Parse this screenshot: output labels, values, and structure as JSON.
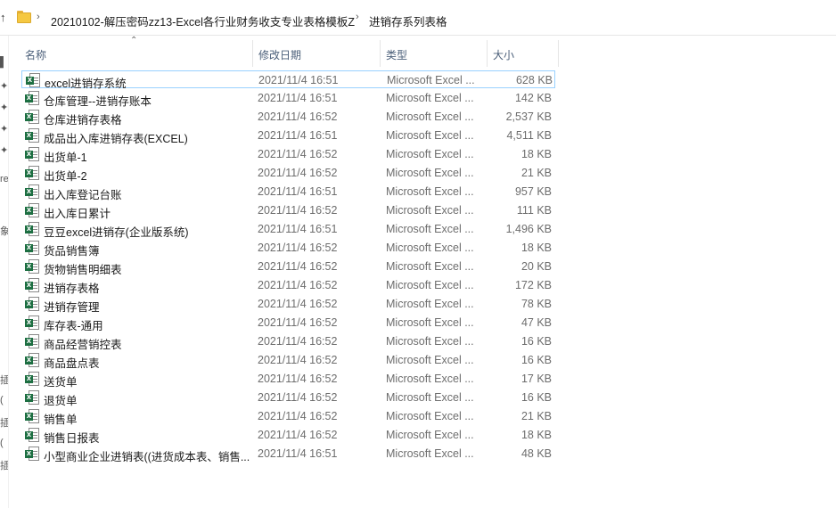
{
  "address": {
    "crumbs": [
      "20210102-解压密码zz13-Excel各行业财务收支专业表格模板Z",
      "进销存系列表格"
    ]
  },
  "nav_fragments": [
    "v",
    "re",
    "象",
    "插",
    "(",
    "插",
    "(",
    "插"
  ],
  "columns": {
    "name": "名称",
    "date": "修改日期",
    "type": "类型",
    "size": "大小"
  },
  "files": [
    {
      "name": "excel进销存系统",
      "date": "2021/11/4 16:51",
      "type": "Microsoft Excel ...",
      "size": "628 KB"
    },
    {
      "name": "仓库管理--进销存账本",
      "date": "2021/11/4 16:51",
      "type": "Microsoft Excel ...",
      "size": "142 KB"
    },
    {
      "name": "仓库进销存表格",
      "date": "2021/11/4 16:52",
      "type": "Microsoft Excel ...",
      "size": "2,537 KB"
    },
    {
      "name": "成品出入库进销存表(EXCEL)",
      "date": "2021/11/4 16:51",
      "type": "Microsoft Excel ...",
      "size": "4,511 KB"
    },
    {
      "name": "出货单-1",
      "date": "2021/11/4 16:52",
      "type": "Microsoft Excel ...",
      "size": "18 KB"
    },
    {
      "name": "出货单-2",
      "date": "2021/11/4 16:52",
      "type": "Microsoft Excel ...",
      "size": "21 KB"
    },
    {
      "name": "出入库登记台账",
      "date": "2021/11/4 16:51",
      "type": "Microsoft Excel ...",
      "size": "957 KB"
    },
    {
      "name": "出入库日累计",
      "date": "2021/11/4 16:52",
      "type": "Microsoft Excel ...",
      "size": "111 KB"
    },
    {
      "name": "豆豆excel进销存(企业版系统)",
      "date": "2021/11/4 16:51",
      "type": "Microsoft Excel ...",
      "size": "1,496 KB"
    },
    {
      "name": "货品销售簿",
      "date": "2021/11/4 16:52",
      "type": "Microsoft Excel ...",
      "size": "18 KB"
    },
    {
      "name": "货物销售明细表",
      "date": "2021/11/4 16:52",
      "type": "Microsoft Excel ...",
      "size": "20 KB"
    },
    {
      "name": "进销存表格",
      "date": "2021/11/4 16:52",
      "type": "Microsoft Excel ...",
      "size": "172 KB"
    },
    {
      "name": "进销存管理",
      "date": "2021/11/4 16:52",
      "type": "Microsoft Excel ...",
      "size": "78 KB"
    },
    {
      "name": "库存表-通用",
      "date": "2021/11/4 16:52",
      "type": "Microsoft Excel ...",
      "size": "47 KB"
    },
    {
      "name": "商品经营销控表",
      "date": "2021/11/4 16:52",
      "type": "Microsoft Excel ...",
      "size": "16 KB"
    },
    {
      "name": "商品盘点表",
      "date": "2021/11/4 16:52",
      "type": "Microsoft Excel ...",
      "size": "16 KB"
    },
    {
      "name": "送货单",
      "date": "2021/11/4 16:52",
      "type": "Microsoft Excel ...",
      "size": "17 KB"
    },
    {
      "name": "退货单",
      "date": "2021/11/4 16:52",
      "type": "Microsoft Excel ...",
      "size": "16 KB"
    },
    {
      "name": "销售单",
      "date": "2021/11/4 16:52",
      "type": "Microsoft Excel ...",
      "size": "21 KB"
    },
    {
      "name": "销售日报表",
      "date": "2021/11/4 16:52",
      "type": "Microsoft Excel ...",
      "size": "18 KB"
    },
    {
      "name": "小型商业企业进销表((进货成本表、销售...",
      "date": "2021/11/4 16:51",
      "type": "Microsoft Excel ...",
      "size": "48 KB"
    }
  ],
  "selected_index": 0
}
